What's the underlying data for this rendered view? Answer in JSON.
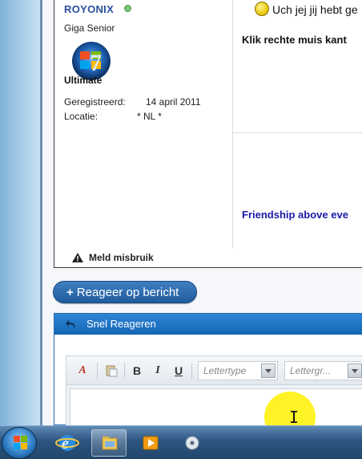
{
  "post": {
    "username": "ROYONIX",
    "user_title": "Giga Senior",
    "avatar_text": "Ultimate",
    "registered_label": "Geregistreerd:",
    "registered_value": "14 april 2011",
    "location_label": "Locatie:",
    "location_value": "* NL *",
    "report_label": "Meld misbruik",
    "message_line1": "Uch jej jij hebt ge",
    "message_line2": "Klik rechte muis kant",
    "signature": "Friendship above eve"
  },
  "actions": {
    "reply_button": "Reageer op bericht",
    "reply_plus": "+"
  },
  "quick_reply": {
    "title": "Snel Reageren",
    "toolbar": {
      "bold": "B",
      "italic": "I",
      "underline": "U",
      "font_placeholder": "Lettertype",
      "size_placeholder": "Lettergr..."
    }
  },
  "taskbar": {
    "items": [
      "start-button",
      "internet-explorer",
      "file-explorer",
      "media-player",
      "dvd-maker"
    ]
  },
  "colors": {
    "link_blue": "#2a4f9c",
    "signature_blue": "#1a1aa8",
    "button_blue": "#1f5c9e",
    "header_blue": "#1565b5",
    "cursor_highlight": "#fff000"
  }
}
